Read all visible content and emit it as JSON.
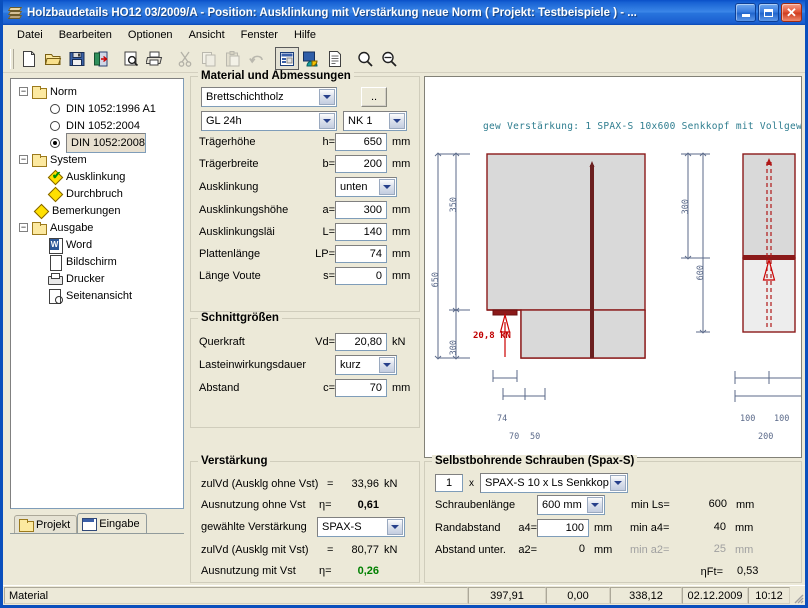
{
  "window": {
    "title": "Holzbaudetails HO12 03/2009/A - Position: Ausklinkung mit Verstärkung neue Norm ( Projekt: Testbeispiele ) - ...",
    "minimize_label": "Minimieren",
    "maximize_label": "Maximieren",
    "close_label": "Schließen"
  },
  "menu": {
    "items": [
      {
        "label": "Datei"
      },
      {
        "label": "Bearbeiten"
      },
      {
        "label": "Optionen"
      },
      {
        "label": "Ansicht"
      },
      {
        "label": "Fenster"
      },
      {
        "label": "Hilfe"
      }
    ]
  },
  "toolbar": {
    "buttons": [
      {
        "name": "new-icon"
      },
      {
        "name": "open-folder-icon"
      },
      {
        "name": "save-disk-icon"
      },
      {
        "name": "exit-door-icon"
      },
      {
        "name": "print-preview-icon"
      },
      {
        "name": "print-icon"
      },
      {
        "name": "cut-scissors-icon"
      },
      {
        "name": "copy-icon"
      },
      {
        "name": "paste-icon"
      },
      {
        "name": "undo-icon"
      },
      {
        "name": "input-form-icon"
      },
      {
        "name": "graphics-icon"
      },
      {
        "name": "document-icon"
      },
      {
        "name": "zoom-in-icon"
      },
      {
        "name": "zoom-out-icon"
      }
    ]
  },
  "tree": {
    "nodes": [
      {
        "label": "Norm",
        "icon": "folder",
        "level": 0,
        "expander": "-"
      },
      {
        "label": "DIN 1052:1996 A1",
        "icon": "radio-off",
        "level": 1
      },
      {
        "label": "DIN 1052:2004",
        "icon": "radio-off",
        "level": 1
      },
      {
        "label": "DIN 1052:2008",
        "icon": "radio-on",
        "level": 1,
        "selected": true
      },
      {
        "label": "System",
        "icon": "folder",
        "level": 0,
        "expander": "-"
      },
      {
        "label": "Ausklinkung",
        "icon": "diamond-check",
        "level": 1
      },
      {
        "label": "Durchbruch",
        "icon": "diamond",
        "level": 1
      },
      {
        "label": "Bemerkungen",
        "icon": "diamond",
        "level": 0
      },
      {
        "label": "Ausgabe",
        "icon": "folder",
        "level": 0,
        "expander": "-"
      },
      {
        "label": "Word",
        "icon": "word",
        "level": 1
      },
      {
        "label": "Bildschirm",
        "icon": "page",
        "level": 1
      },
      {
        "label": "Drucker",
        "icon": "printer",
        "level": 1
      },
      {
        "label": "Seitenansicht",
        "icon": "preview",
        "level": 1
      }
    ]
  },
  "left_tabs": [
    {
      "label": "Projekt",
      "active": false,
      "icon": "folder-icon"
    },
    {
      "label": "Eingabe",
      "active": true,
      "icon": "form-icon"
    }
  ],
  "material": {
    "legend": "Material und Abmessungen",
    "material_type": "Brettschichtholz",
    "browse_button": "..",
    "grade": "GL 24h",
    "service_class": "NK 1",
    "rows": [
      {
        "label": "Trägerhöhe",
        "symbol": "h=",
        "value": "650",
        "unit": "mm"
      },
      {
        "label": "Trägerbreite",
        "symbol": "b=",
        "value": "200",
        "unit": "mm"
      },
      {
        "label": "Ausklinkung",
        "symbol": "",
        "value": "unten",
        "unit": "",
        "type": "select"
      },
      {
        "label": "Ausklinkungshöhe",
        "symbol": "a=",
        "value": "300",
        "unit": "mm"
      },
      {
        "label": "Ausklinkungsläi",
        "symbol": "L=",
        "value": "140",
        "unit": "mm"
      },
      {
        "label": "Plattenlänge",
        "symbol": "LP=",
        "value": "74",
        "unit": "mm"
      },
      {
        "label": "Länge Voute",
        "symbol": "s=",
        "value": "0",
        "unit": "mm"
      }
    ]
  },
  "schnittgroessen": {
    "legend": "Schnittgrößen",
    "rows": [
      {
        "label": "Querkraft",
        "symbol": "Vd=",
        "value": "20,80",
        "unit": "kN"
      },
      {
        "label": "Lasteinwirkungsdauer",
        "symbol": "",
        "value": "kurz",
        "unit": "",
        "type": "select"
      },
      {
        "label": "Abstand",
        "symbol": "c=",
        "value": "70",
        "unit": "mm"
      }
    ]
  },
  "verstaerkung": {
    "legend": "Verstärkung",
    "rows": [
      {
        "label": "zulVd (Ausklg ohne Vst)",
        "symbol": "=",
        "value": "33,96",
        "unit": "kN",
        "style": "plain"
      },
      {
        "label": "Ausnutzung ohne Vst",
        "symbol": "η=",
        "value": "0,61",
        "unit": "",
        "style": "bold"
      },
      {
        "label": "gewählte Verstärkung",
        "symbol": "",
        "value": "SPAX-S",
        "unit": "",
        "style": "select"
      },
      {
        "label": "zulVd (Ausklg mit Vst)",
        "symbol": "=",
        "value": "80,77",
        "unit": "kN",
        "style": "plain"
      },
      {
        "label": "Ausnutzung mit Vst",
        "symbol": "η=",
        "value": "0,26",
        "unit": "",
        "style": "green"
      }
    ]
  },
  "schrauben": {
    "legend": "Selbstbohrende Schrauben (Spax-S)",
    "count": "1",
    "multiplier": "x",
    "screw_type": "SPAX-S 10 x Ls  Senkkop",
    "rows": [
      {
        "label": "Schraubenlänge",
        "symbol": "",
        "value": "600 mm",
        "unit": "",
        "min_label": "min Ls=",
        "min_value": "600",
        "min_unit": "mm",
        "type": "select"
      },
      {
        "label": "Randabstand",
        "symbol": "a4=",
        "value": "100",
        "unit": "mm",
        "min_label": "min a4=",
        "min_value": "40",
        "min_unit": "mm",
        "type": "input"
      },
      {
        "label": "Abstand unter.",
        "symbol": "a2=",
        "value": "0",
        "unit": "mm",
        "min_label": "min a2=",
        "min_value": "25",
        "min_unit": "mm",
        "type": "readonly",
        "disabled": true
      }
    ],
    "eta_label": "ηFt=",
    "eta_value": "0,53"
  },
  "drawing": {
    "caption": "gew Verstärkung:  1 SPAX-S 10x600 Senkkopf mit Vollgew",
    "left_view": {
      "dim_total_height": "650",
      "dim_upper": "350",
      "dim_lower": "300",
      "load_label": "20,8 kN",
      "dim_plate": "74",
      "dim_a": "70",
      "dim_b": "50"
    },
    "right_view": {
      "dim_upper": "300",
      "dim_total": "600",
      "dim_left": "100",
      "dim_right": "100",
      "dim_width": "200"
    },
    "colors": {
      "outline": "#8b1a1a",
      "fill": "#d9d9d9",
      "fill_light": "#ededed",
      "screw": "#6b1f1f",
      "dim": "#5b6a8a",
      "caption": "#2e7d8f",
      "load": "#c00000"
    }
  },
  "statusbar": {
    "message": "Material",
    "field1": "397,91",
    "field2": "0,00",
    "field3": "338,12",
    "date": "02.12.2009",
    "time": "10:12"
  }
}
